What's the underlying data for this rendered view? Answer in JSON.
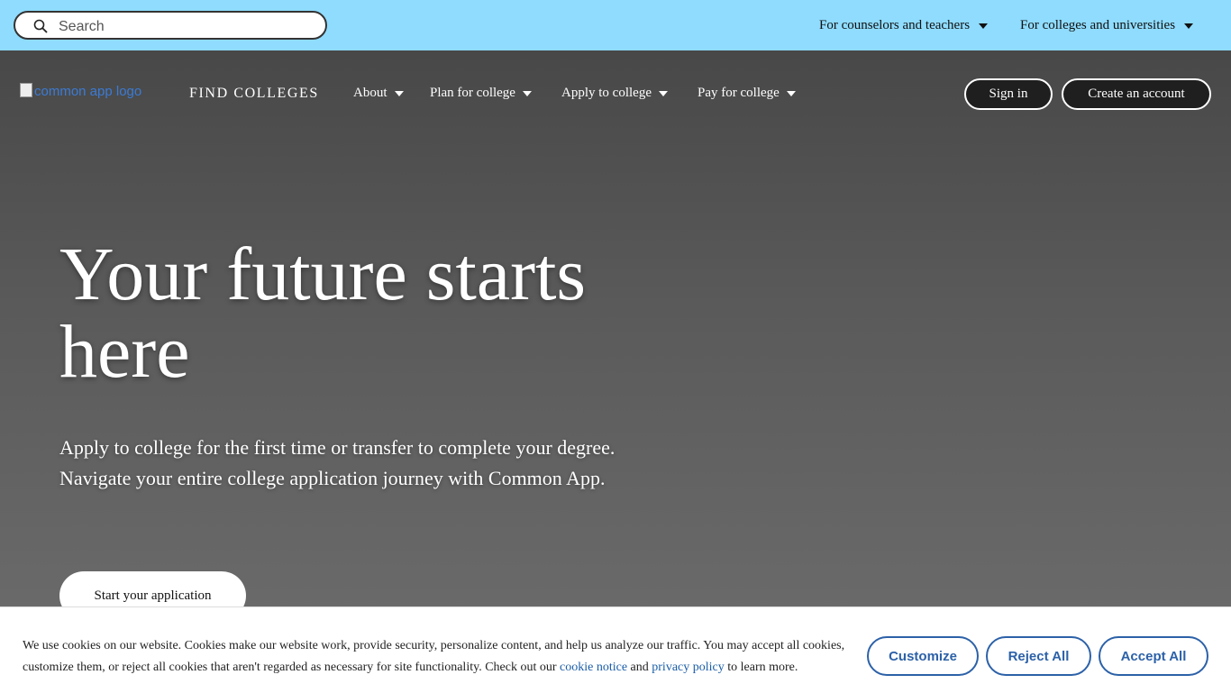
{
  "topbar": {
    "search_placeholder": "Search",
    "links": [
      "For counselors and teachers",
      "For colleges and universities"
    ]
  },
  "nav": {
    "logo_alt": "common app logo",
    "find_colleges": "FIND COLLEGES",
    "items": [
      "About",
      "Plan for college",
      "Apply to college",
      "Pay for college"
    ],
    "sign_in": "Sign in",
    "create_account": "Create an account"
  },
  "hero": {
    "title": "Your future starts here",
    "subtitle": "Apply to college for the first time or transfer to complete your degree. Navigate your entire college application journey with Common App.",
    "cta": "Start your application"
  },
  "cookie_banner": {
    "text_before": "We use cookies on our website. Cookies make our website work, provide security, personalize content, and help us analyze our traffic. You may accept all cookies, customize them, or reject all cookies that aren't regarded as necessary for site functionality. Check out our ",
    "cookie_notice_link": "cookie notice",
    "text_middle": " and ",
    "privacy_policy_link": "privacy policy",
    "text_after": " to learn more.",
    "customize": "Customize",
    "reject_all": "Reject All",
    "accept_all": "Accept All"
  },
  "colors": {
    "topbar_bg": "#8fdcfe",
    "cookie_button": "#2c61a8",
    "link": "#1a5da8"
  }
}
